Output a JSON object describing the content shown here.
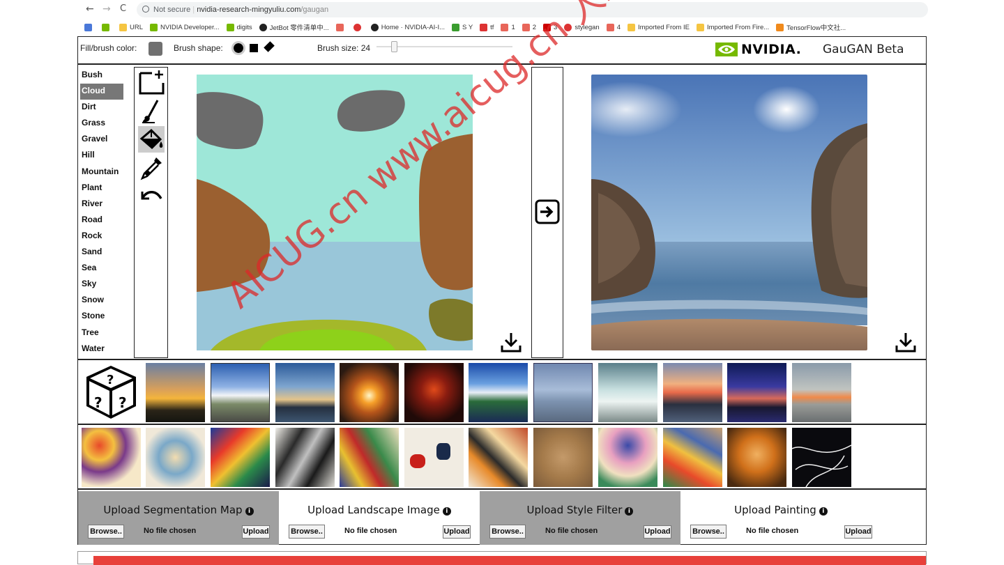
{
  "browser": {
    "back": "←",
    "forward": "→",
    "reload": "C",
    "security": "Not secure",
    "domain": "nvidia-research-mingyuliu.com",
    "path": "/gaugan",
    "bookmarks": [
      "URL",
      "NVIDIA Developer...",
      "digits",
      "JetBot 零件清单中...",
      "Home · NVIDIA-AI-I...",
      "S Y",
      "tf",
      "1",
      "2",
      "3",
      "stylegan",
      "4",
      "Imported From IE",
      "Imported From Fire...",
      "TensorFlow中文社..."
    ]
  },
  "toolbar": {
    "fill_label": "Fill/brush color:",
    "fill_color": "#707070",
    "shape_label": "Brush shape:",
    "size_label": "Brush size: 24",
    "brand": "NVIDIA.",
    "app_title": "GauGAN Beta"
  },
  "labels": [
    "Bush",
    "Cloud",
    "Dirt",
    "Grass",
    "Gravel",
    "Hill",
    "Mountain",
    "Plant",
    "River",
    "Road",
    "Rock",
    "Sand",
    "Sea",
    "Sky",
    "Snow",
    "Stone",
    "Tree",
    "Water"
  ],
  "selected_label": "Cloud",
  "tools": [
    "new-canvas-icon",
    "brush-icon",
    "fill-bucket-icon",
    "eyedropper-icon",
    "undo-icon"
  ],
  "selected_tool": "fill-bucket-icon",
  "colors": {
    "sky": "#9ee7d8",
    "sea": "#99c6d9",
    "rock": "#9b6030",
    "cloud": "#6b6b6b",
    "grass": "#a4b82a",
    "grass_light": "#8ed11a",
    "tree": "#7d7a2a"
  },
  "uploads": [
    {
      "title": "Upload Segmentation Map",
      "browse": "Browse..",
      "status": "No file chosen",
      "action": "Upload"
    },
    {
      "title": "Upload Landscape Image",
      "browse": "Browse..",
      "status": "No file chosen",
      "action": "Upload"
    },
    {
      "title": "Upload Style Filter",
      "browse": "Browse..",
      "status": "No file chosen",
      "action": "Upload"
    },
    {
      "title": "Upload Painting",
      "browse": "Browse..",
      "status": "No file chosen",
      "action": "Upload"
    }
  ],
  "watermark": "AICUG.cn www.aicug.cn 人工智能技术社区"
}
